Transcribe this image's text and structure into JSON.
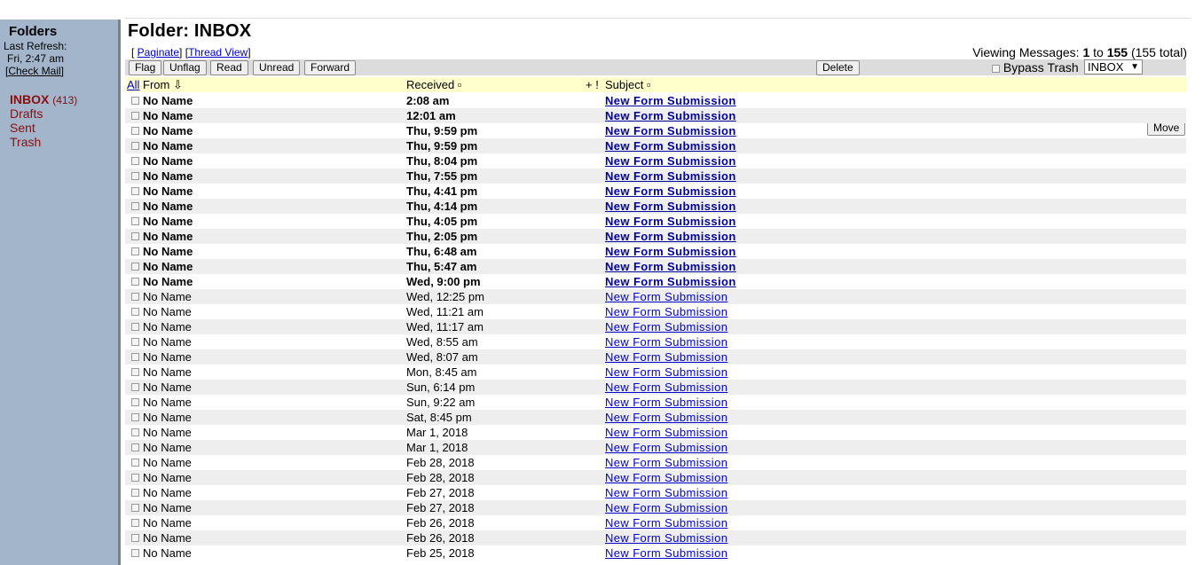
{
  "sidebar": {
    "title": "Folders",
    "last_refresh_label": "Last Refresh:",
    "last_refresh_time": "Fri, 2:47 am",
    "check_mail": "[Check Mail]",
    "folders": [
      {
        "name": "INBOX",
        "count": "(413)"
      },
      {
        "name": "Drafts"
      },
      {
        "name": "Sent"
      },
      {
        "name": "Trash"
      }
    ]
  },
  "header": {
    "folder_title": "Folder: INBOX",
    "bracket_open": "[ ",
    "paginate": "Paginate",
    "bracket_mid": "] [",
    "thread_view": "Thread View",
    "bracket_close": "]",
    "viewing_label": "Viewing Messages: ",
    "range_from": "1",
    "to_word": " to ",
    "range_to": "155",
    "total": " (155 total)"
  },
  "toolbar": {
    "flag": "Flag",
    "unflag": "Unflag",
    "read": "Read",
    "unread": "Unread",
    "forward": "Forward",
    "delete": "Delete",
    "bypass_trash": "Bypass Trash",
    "move_target": "INBOX",
    "move": "Move"
  },
  "columns": {
    "all": "All",
    "from": "From ⇩",
    "received": "Received ▫",
    "flags": "+ !",
    "subject": "Subject ▫"
  },
  "messages": [
    {
      "from": "No Name",
      "received": "2:08 am",
      "subject": "New Form Submission",
      "unread": true
    },
    {
      "from": "No Name",
      "received": "12:01 am",
      "subject": "New Form Submission",
      "unread": true
    },
    {
      "from": "No Name",
      "received": "Thu, 9:59 pm",
      "subject": "New Form Submission",
      "unread": true
    },
    {
      "from": "No Name",
      "received": "Thu, 9:59 pm",
      "subject": "New Form Submission",
      "unread": true
    },
    {
      "from": "No Name",
      "received": "Thu, 8:04 pm",
      "subject": "New Form Submission",
      "unread": true
    },
    {
      "from": "No Name",
      "received": "Thu, 7:55 pm",
      "subject": "New Form Submission",
      "unread": true
    },
    {
      "from": "No Name",
      "received": "Thu, 4:41 pm",
      "subject": "New Form Submission",
      "unread": true
    },
    {
      "from": "No Name",
      "received": "Thu, 4:14 pm",
      "subject": "New Form Submission",
      "unread": true
    },
    {
      "from": "No Name",
      "received": "Thu, 4:05 pm",
      "subject": "New Form Submission",
      "unread": true
    },
    {
      "from": "No Name",
      "received": "Thu, 2:05 pm",
      "subject": "New Form Submission",
      "unread": true
    },
    {
      "from": "No Name",
      "received": "Thu, 6:48 am",
      "subject": "New Form Submission",
      "unread": true
    },
    {
      "from": "No Name",
      "received": "Thu, 5:47 am",
      "subject": "New Form Submission",
      "unread": true
    },
    {
      "from": "No Name",
      "received": "Wed, 9:00 pm",
      "subject": "New Form Submission",
      "unread": true
    },
    {
      "from": "No Name",
      "received": "Wed, 12:25 pm",
      "subject": "New Form Submission",
      "unread": false
    },
    {
      "from": "No Name",
      "received": "Wed, 11:21 am",
      "subject": "New Form Submission",
      "unread": false
    },
    {
      "from": "No Name",
      "received": "Wed, 11:17 am",
      "subject": "New Form Submission",
      "unread": false
    },
    {
      "from": "No Name",
      "received": "Wed, 8:55 am",
      "subject": "New Form Submission",
      "unread": false
    },
    {
      "from": "No Name",
      "received": "Wed, 8:07 am",
      "subject": "New Form Submission",
      "unread": false
    },
    {
      "from": "No Name",
      "received": "Mon, 8:45 am",
      "subject": "New Form Submission",
      "unread": false
    },
    {
      "from": "No Name",
      "received": "Sun, 6:14 pm",
      "subject": "New Form Submission",
      "unread": false
    },
    {
      "from": "No Name",
      "received": "Sun, 9:22 am",
      "subject": "New Form Submission",
      "unread": false
    },
    {
      "from": "No Name",
      "received": "Sat, 8:45 pm",
      "subject": "New Form Submission",
      "unread": false
    },
    {
      "from": "No Name",
      "received": "Mar 1, 2018",
      "subject": "New Form Submission",
      "unread": false
    },
    {
      "from": "No Name",
      "received": "Mar 1, 2018",
      "subject": "New Form Submission",
      "unread": false
    },
    {
      "from": "No Name",
      "received": "Feb 28, 2018",
      "subject": "New Form Submission",
      "unread": false
    },
    {
      "from": "No Name",
      "received": "Feb 28, 2018",
      "subject": "New Form Submission",
      "unread": false
    },
    {
      "from": "No Name",
      "received": "Feb 27, 2018",
      "subject": "New Form Submission",
      "unread": false
    },
    {
      "from": "No Name",
      "received": "Feb 27, 2018",
      "subject": "New Form Submission",
      "unread": false
    },
    {
      "from": "No Name",
      "received": "Feb 26, 2018",
      "subject": "New Form Submission",
      "unread": false
    },
    {
      "from": "No Name",
      "received": "Feb 26, 2018",
      "subject": "New Form Submission",
      "unread": false
    },
    {
      "from": "No Name",
      "received": "Feb 25, 2018",
      "subject": "New Form Submission",
      "unread": false
    }
  ],
  "colors": {
    "sidebar_bg": "#a2b5cb",
    "folder_link": "#8b0e0e",
    "header_row": "#ffffcc",
    "link": "#0000cc"
  }
}
